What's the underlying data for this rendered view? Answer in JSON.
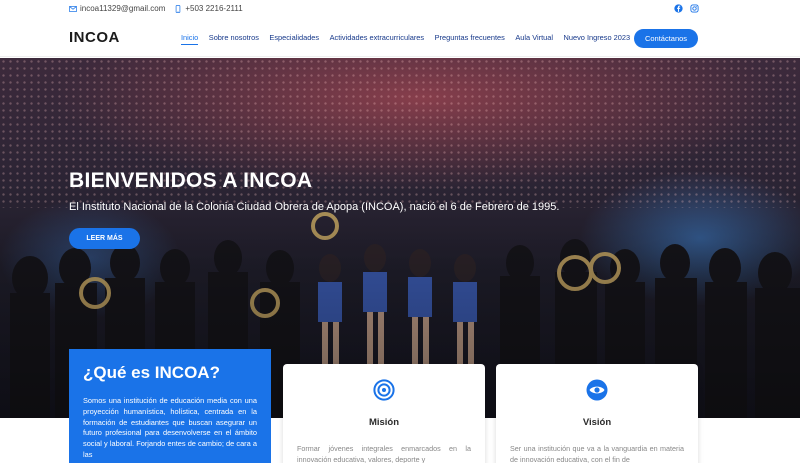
{
  "topbar": {
    "email": "incoa11329@gmail.com",
    "phone": "+503 2216-2111",
    "social_icons": [
      "facebook-icon",
      "instagram-icon"
    ]
  },
  "header": {
    "logo": "INCOA",
    "nav": [
      {
        "label": "Inicio",
        "active": true
      },
      {
        "label": "Sobre nosotros",
        "active": false
      },
      {
        "label": "Especialidades",
        "active": false
      },
      {
        "label": "Actividades extracurriculares",
        "active": false
      },
      {
        "label": "Preguntas frecuentes",
        "active": false
      },
      {
        "label": "Aula Virtual",
        "active": false
      },
      {
        "label": "Nuevo Ingreso 2023",
        "active": false
      }
    ],
    "cta": "Contáctanos"
  },
  "hero": {
    "title": "BIENVENIDOS A INCOA",
    "subtitle": "El Instituto Nacional de la Colonia Ciudad Obrera de Apopa (INCOA), nació el 6 de Febrero de 1995.",
    "button": "LEER MÁS"
  },
  "about": {
    "title": "¿Qué es INCOA?",
    "text": "Somos una institución de educación media con una proyección humanística, holística, centrada en la formación de estudiantes que buscan asegurar un futuro profesional para desenvolverse en el ámbito social y laboral. Forjando entes de cambio; de cara a las"
  },
  "cards": [
    {
      "title": "Misión",
      "icon": "target-icon",
      "text": "Formar jóvenes integrales enmarcados en la innovación educativa, valores, deporte y"
    },
    {
      "title": "Visión",
      "icon": "eye-icon",
      "text": "Ser una institución que va a la vanguardia en materia de innovación educativa, con el fin de"
    }
  ],
  "colors": {
    "accent": "#1a73e8",
    "nav_text": "#16388a",
    "logo": "#1b1b1b"
  }
}
